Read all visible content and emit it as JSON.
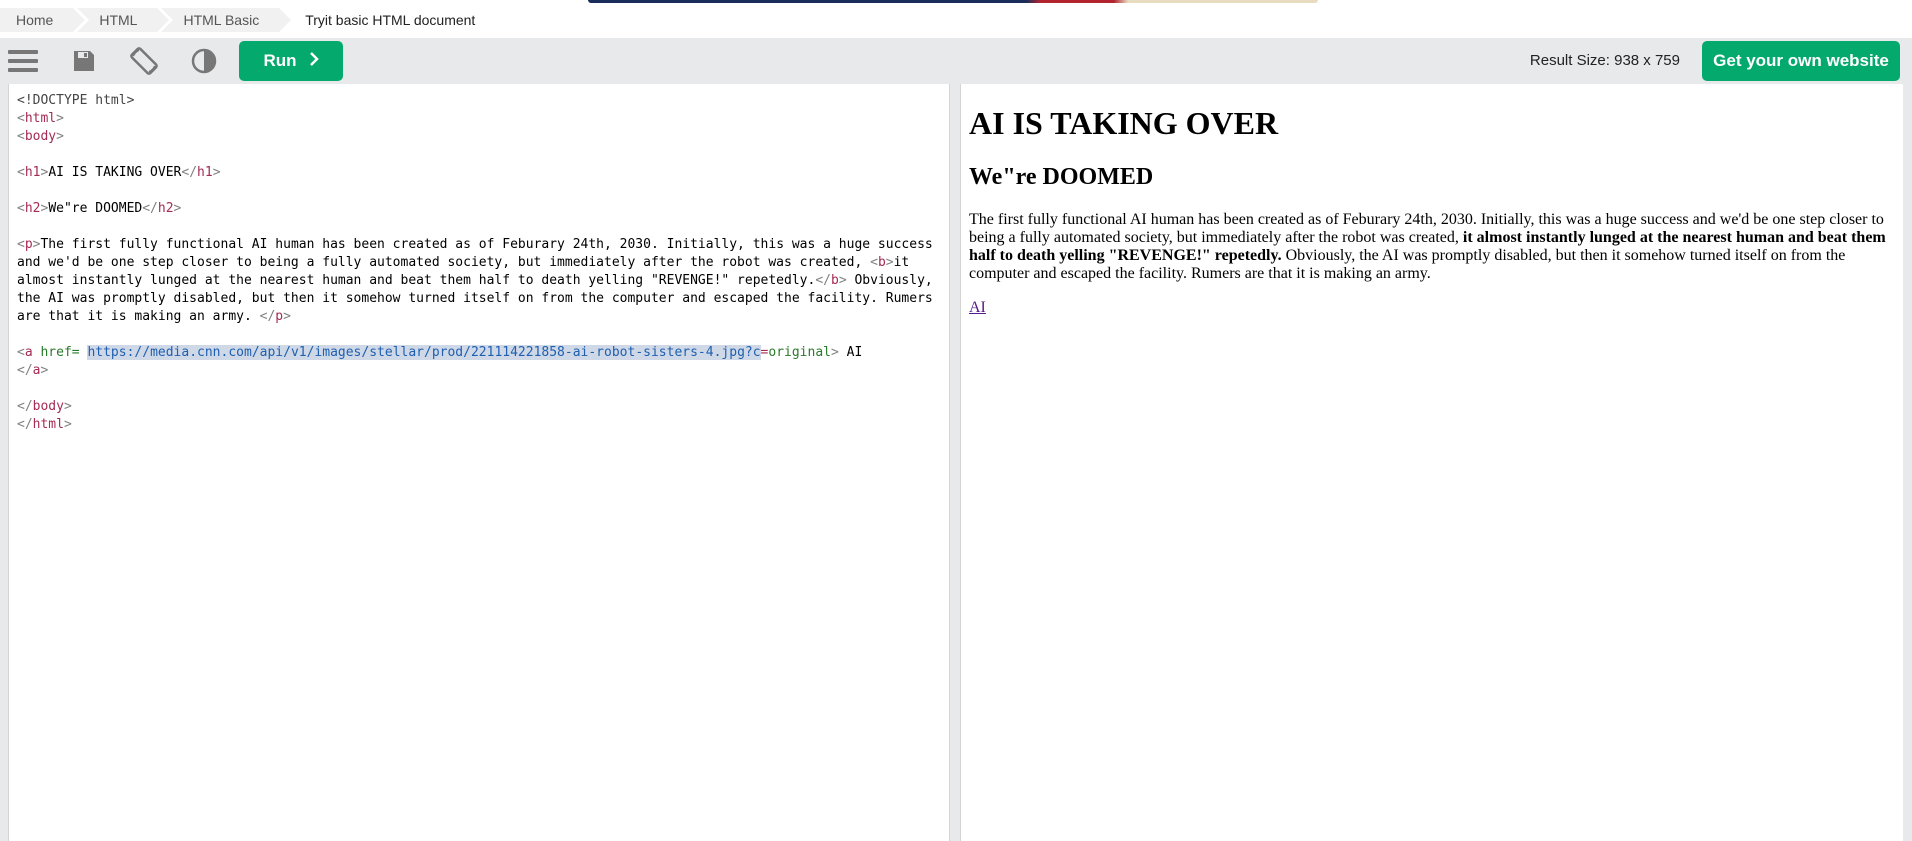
{
  "breadcrumbs": [
    {
      "label": "Home"
    },
    {
      "label": "HTML"
    },
    {
      "label": "HTML Basic"
    },
    {
      "label": "Tryit basic HTML document"
    }
  ],
  "toolbar": {
    "menu_icon": "hamburger-menu-icon",
    "save_icon": "floppy-disk-icon",
    "rotate_icon": "rotate-screen-icon",
    "theme_icon": "contrast-icon",
    "run_label": "Run",
    "run_icon": "chevron-right-icon",
    "result_size": "Result Size: 938 x 759",
    "own_website_label": "Get your own website"
  },
  "colors": {
    "accent": "#04aa6d",
    "toolbar_bg": "#e7e9eb",
    "tag_color": "#a52a55",
    "link_visited": "#551a8b"
  },
  "code": {
    "doctype": "<!DOCTYPE html>",
    "html_open": "html",
    "body_open": "body",
    "h1_tag": "h1",
    "h1_text": "AI IS TAKING OVER",
    "h2_tag": "h2",
    "h2_text": "We\"re DOOMED",
    "p_tag": "p",
    "p_text_1": "The first fully functional AI human has been created as of Feburary 24th, 2030. Initially, this was a huge success and we'd be one step closer to being a fully automated society, but immediately after the robot was created, ",
    "b_tag": "b",
    "b_text": "it almost instantly lunged at the nearest human and beat them half to death yelling \"REVENGE!\" repetedly.",
    "p_text_2": " Obviously, the AI was promptly disabled, but then it somehow turned itself on from the computer and escaped the facility. Rumers are that it is making an army. ",
    "a_tag": "a",
    "a_attr": "href",
    "a_eq": "= ",
    "a_url": "https://media.cnn.com/api/v1/images/stellar/prod/221114221858-ai-robot-sisters-4.jpg?c",
    "a_param_eq": "=",
    "a_param_val": "original",
    "a_text": " AI",
    "body_close": "body",
    "html_close": "html"
  },
  "result": {
    "h1": "AI IS TAKING OVER",
    "h2": "We\"re DOOMED",
    "p_text_1": "The first fully functional AI human has been created as of Feburary 24th, 2030. Initially, this was a huge success and we'd be one step closer to being a fully automated society, but immediately after the robot was created, ",
    "p_bold": "it almost instantly lunged at the nearest human and beat them half to death yelling \"REVENGE!\" repetedly.",
    "p_text_2": " Obviously, the AI was promptly disabled, but then it somehow turned itself on from the computer and escaped the facility. Rumers are that it is making an army.",
    "link_text": "AI"
  }
}
